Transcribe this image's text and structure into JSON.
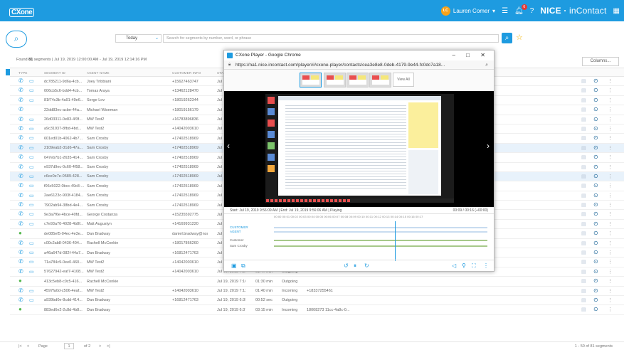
{
  "header": {
    "app_logo": "CXone",
    "user_initials": "LC",
    "user_name": "Lauren Comer",
    "notif_count": "6",
    "brand": "NICE",
    "brand_suffix": "inContact"
  },
  "search": {
    "time_filter": "Today",
    "placeholder": "Search for segments by number, word, or phrase"
  },
  "results": {
    "found_prefix": "Found",
    "found_count": "81",
    "found_text": "segments | Jul 19, 2019 12:00:00 AM - Jul 19, 2019 12:14:16 PM",
    "columns_button": "Columns..."
  },
  "table": {
    "headers": [
      "TYPE",
      "SEGMENT ID",
      "AGENT NAME",
      "CUSTOMER INFO",
      "START"
    ],
    "rows": [
      {
        "seg": "dc785211-9d6a-4cb...",
        "agent": "Joey Tribbiani",
        "cust": "+15627463747",
        "start": "Jul 1",
        "dur": "",
        "dir": "",
        "dnis": "",
        "green": false,
        "chat": true
      },
      {
        "seg": "006cb5c6-bdd4-4cb...",
        "agent": "Tomas Araya",
        "cust": "+13462128470",
        "start": "Jul 1",
        "dur": "",
        "dir": "",
        "dnis": "",
        "green": false,
        "chat": true
      },
      {
        "seg": "81f74c3b-4a91-49e6...",
        "agent": "Serge Lov",
        "cust": "+18019262344",
        "start": "Jul 1",
        "dur": "",
        "dir": "",
        "dnis": "",
        "green": false,
        "chat": true
      },
      {
        "seg": "22dd83ec-acbe-44a...",
        "agent": "Michael Wiseman",
        "cust": "+18019156179",
        "start": "Jul 1",
        "dur": "",
        "dir": "",
        "dnis": "",
        "green": false,
        "chat": false
      },
      {
        "seg": "26d03311-0e83-4f3f...",
        "agent": "MW Test2",
        "cust": "+16783896836",
        "start": "Jul 1",
        "dur": "",
        "dir": "",
        "dnis": "",
        "green": false,
        "chat": true
      },
      {
        "seg": "a9c31937-8fbd-4bd...",
        "agent": "MW Test2",
        "cust": "+14042003610",
        "start": "Jul 1",
        "dur": "",
        "dir": "",
        "dnis": "",
        "green": false,
        "chat": true
      },
      {
        "seg": "601ed01b-4062-4b7...",
        "agent": "Sam Crosby",
        "cust": "+17402518969",
        "start": "Jul 1",
        "dur": "",
        "dir": "",
        "dnis": "",
        "green": false,
        "chat": true
      },
      {
        "seg": "2109eab2-31d6-47a...",
        "agent": "Sam Crosby",
        "cust": "+17402518969",
        "start": "Jul 1",
        "dur": "",
        "dir": "",
        "dnis": "",
        "green": false,
        "chat": true,
        "sel": true
      },
      {
        "seg": "047eb7b1-2635-414...",
        "agent": "Sam Crosby",
        "cust": "+17402518969",
        "start": "Jul 1",
        "dur": "",
        "dir": "",
        "dnis": "",
        "green": false,
        "chat": true
      },
      {
        "seg": "e937d9ec-0c60-4f58...",
        "agent": "Sam Crosby",
        "cust": "+17402518969",
        "start": "Jul 1",
        "dur": "",
        "dir": "",
        "dnis": "",
        "green": false,
        "chat": true
      },
      {
        "seg": "c6ce0e7e-0589-428...",
        "agent": "Sam Crosby",
        "cust": "+17402518969",
        "start": "Jul 1",
        "dur": "",
        "dir": "",
        "dnis": "",
        "green": false,
        "chat": true,
        "sel": true
      },
      {
        "seg": "f06c5022-0bcc-49c8-...",
        "agent": "Sam Crosby",
        "cust": "+17402518969",
        "start": "Jul 1",
        "dur": "",
        "dir": "",
        "dnis": "",
        "green": false,
        "chat": true
      },
      {
        "seg": "2ae6123c-903f-4184...",
        "agent": "Sam Crosby",
        "cust": "+17402518969",
        "start": "Jul 1",
        "dur": "",
        "dir": "",
        "dnis": "",
        "green": false,
        "chat": true
      },
      {
        "seg": "7902ab94-38bd-4e4...",
        "agent": "Sam Crosby",
        "cust": "+17402518969",
        "start": "Jul 1",
        "dur": "",
        "dir": "",
        "dnis": "",
        "green": false,
        "chat": true
      },
      {
        "seg": "9e3a7f6e-4bce-40fd...",
        "agent": "George Costanza",
        "cust": "+15235592775",
        "start": "Jul 1",
        "dur": "",
        "dir": "",
        "dnis": "",
        "green": false,
        "chat": true
      },
      {
        "seg": "c7e93a70-4028-4b8f...",
        "agent": "Matt Augustyn",
        "cust": "+14169931220",
        "start": "Jul 1",
        "dur": "",
        "dir": "",
        "dnis": "",
        "green": false,
        "chat": true
      },
      {
        "seg": "de085ef5-04ec-4e3e...",
        "agent": "Dan Bradway",
        "cust": "daniel.bradway@ncein...",
        "start": "Jul 1",
        "dur": "",
        "dir": "",
        "dnis": "",
        "green": true,
        "chat": false
      },
      {
        "seg": "c00c2ab8-0436-404...",
        "agent": "Rachell McConkie",
        "cust": "+18017866260",
        "start": "Jul 1",
        "dur": "",
        "dir": "",
        "dnis": "",
        "green": false,
        "chat": true
      },
      {
        "seg": "a46a647d-082f-44a7...",
        "agent": "Dan Bradway",
        "cust": "+16812471763",
        "start": "Jul 19, 2019 7:47:19 AM",
        "dur": "05:07 min",
        "dir": "Outgoing",
        "dnis": "",
        "green": false,
        "chat": true
      },
      {
        "seg": "71a784c9-0ee0-460...",
        "agent": "MW Test2",
        "cust": "+14042003610",
        "start": "Jul 19, 2019 7:28:27 AM",
        "dur": "00:08 sec",
        "dir": "Incoming",
        "dnis": "+18337255461",
        "green": false,
        "chat": true
      },
      {
        "seg": "57627942-eaf7-4108...",
        "agent": "MW Test2",
        "cust": "+14042003610",
        "start": "Jul 19, 2019 7:26:29 AM",
        "dur": "01:47 min",
        "dir": "Outgoing",
        "dnis": "",
        "green": false,
        "chat": true
      },
      {
        "seg": "413c5eb8-c0c5-416...",
        "agent": "Rachell McConkie",
        "cust": "",
        "start": "Jul 19, 2019 7:16:34 AM",
        "dur": "01:30 min",
        "dir": "Outgoing",
        "dnis": "",
        "green": true,
        "chat": false
      },
      {
        "seg": "4597fa0d-c506-4eaf...",
        "agent": "MW Test2",
        "cust": "+14042003610",
        "start": "Jul 19, 2019 7:12:29 AM",
        "dur": "01:40 min",
        "dir": "Incoming",
        "dnis": "+18337255461",
        "green": false,
        "chat": true
      },
      {
        "seg": "a939bd0e-8cdd-414...",
        "agent": "Dan Bradway",
        "cust": "+16812471763",
        "start": "Jul 19, 2019 6:39:28 AM",
        "dur": "00:52 sec",
        "dir": "Outgoing",
        "dnis": "",
        "green": false,
        "chat": true
      },
      {
        "seg": "883ed6e2-2c8d-4b8...",
        "agent": "Dan Bradway",
        "cust": "",
        "start": "Jul 19, 2019 6:37:29 AM",
        "dur": "03:15 min",
        "dir": "Incoming",
        "dnis": "18008273 11cc-4a8c-0...",
        "green": true,
        "chat": false
      }
    ]
  },
  "footer": {
    "page_label": "Page",
    "page_num": "1",
    "page_of": "of 2",
    "summary": "1 - 50 of 81 segments"
  },
  "player": {
    "title": "CXone Player - Google Chrome",
    "url": "https://na1.nice-incontact.com/player/#/cxone-player/contacts/cea3e8e8-0deb-4179-9e44-fc0dc7a18...",
    "view_all": "View All",
    "info_start": "Start: Jul 19, 2019 9:56:09 AM",
    "info_end": "End: Jul 19, 2019 9:56:06 AM",
    "info_status": "Playing",
    "info_time": "00:09 / 00:16 (+00:00)",
    "ticks": "00:00  00:01  00:02  00:03  00:04  00:05  00:06  00:07  00:08  00:09  00:10  00:11  00:12  00:13  00:14  00:15  00:16  00:17",
    "tracks": {
      "customer": "CUSTOMER",
      "agent": "AGENT",
      "customer_lbl": "Customer",
      "agent_lbl": "Sam Crosby"
    }
  }
}
